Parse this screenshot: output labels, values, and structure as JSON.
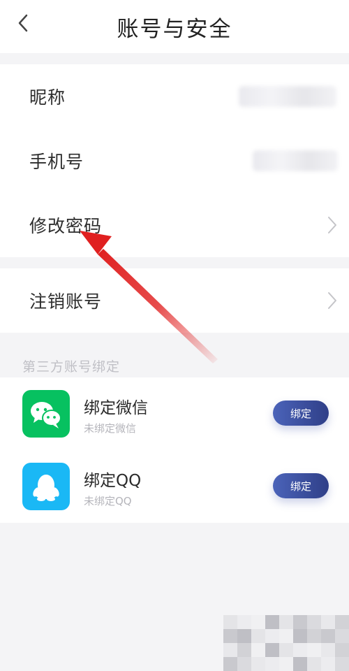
{
  "header": {
    "title": "账号与安全"
  },
  "account_rows": [
    {
      "label": "昵称"
    },
    {
      "label": "手机号"
    },
    {
      "label": "修改密码"
    }
  ],
  "deactivate_row": {
    "label": "注销账号"
  },
  "third_party": {
    "section_label": "第三方账号绑定",
    "items": [
      {
        "title": "绑定微信",
        "subtitle": "未绑定微信",
        "button": "绑定",
        "icon": "wechat-icon",
        "color": "#07c160"
      },
      {
        "title": "绑定QQ",
        "subtitle": "未绑定QQ",
        "button": "绑定",
        "icon": "qq-icon",
        "color": "#1ab8f5"
      }
    ]
  },
  "colors": {
    "accent": "#3f55a8",
    "arrow": "#e02020"
  }
}
